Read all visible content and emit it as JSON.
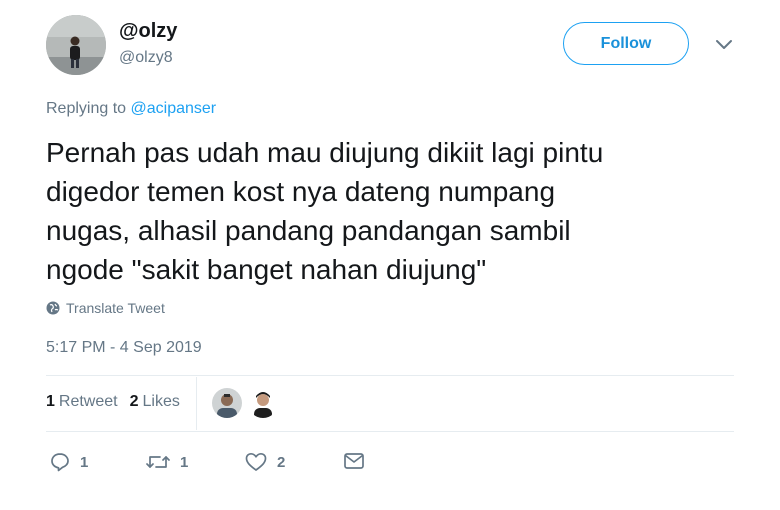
{
  "author": {
    "display_name": "@olzy",
    "handle": "@olzy8"
  },
  "follow_button": {
    "label": "Follow"
  },
  "reply": {
    "prefix": "Replying to",
    "mention": "@acipanser"
  },
  "tweet": {
    "lines": [
      "Pernah pas udah mau diujung dikiit lagi pintu",
      "digedor temen kost nya dateng numpang",
      "nugas, alhasil pandang pandangan sambil",
      "ngode \"sakit banget nahan diujung\""
    ],
    "translate_label": "Translate Tweet",
    "timestamp": "5:17 PM - 4 Sep 2019"
  },
  "stats": {
    "retweets_count": "1",
    "retweets_label": "Retweet",
    "likes_count": "2",
    "likes_label": "Likes"
  },
  "actions": {
    "reply_count": "1",
    "retweet_count": "1",
    "like_count": "2"
  },
  "colors": {
    "accent": "#1da1f2",
    "text": "#14171a",
    "secondary": "#657786",
    "divider": "#e6ecf0"
  },
  "icons": [
    "globe-icon",
    "chevron-down-icon",
    "reply-icon",
    "retweet-icon",
    "heart-icon",
    "mail-icon"
  ]
}
